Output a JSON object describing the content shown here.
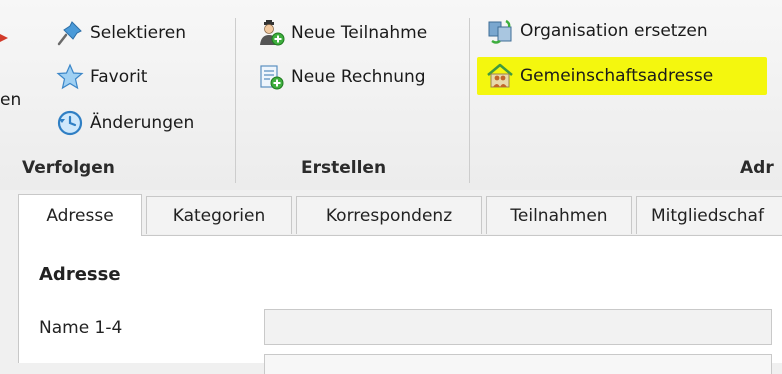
{
  "ribbon": {
    "left_cut_label": "en",
    "groups": [
      {
        "label": "Verfolgen",
        "buttons": [
          {
            "label": "Selektieren",
            "icon": "pin-icon"
          },
          {
            "label": "Favorit",
            "icon": "star-icon"
          },
          {
            "label": "Änderungen",
            "icon": "history-icon"
          }
        ]
      },
      {
        "label": "Erstellen",
        "buttons": [
          {
            "label": "Neue Teilnahme",
            "icon": "person-add-icon"
          },
          {
            "label": "Neue Rechnung",
            "icon": "invoice-add-icon"
          }
        ]
      },
      {
        "label": "Adr",
        "buttons": [
          {
            "label": "Organisation ersetzen",
            "icon": "replace-icon"
          },
          {
            "label": "Gemeinschaftsadresse",
            "icon": "house-people-icon",
            "highlighted": true
          }
        ]
      }
    ]
  },
  "tabs": [
    {
      "label": "Adresse",
      "active": true
    },
    {
      "label": "Kategorien",
      "active": false
    },
    {
      "label": "Korrespondenz",
      "active": false
    },
    {
      "label": "Teilnahmen",
      "active": false
    },
    {
      "label": "Mitgliedschaf",
      "active": false
    }
  ],
  "content": {
    "section_title": "Adresse",
    "fields": [
      {
        "label": "Name 1-4",
        "value": ""
      }
    ]
  },
  "colors": {
    "highlight": "#f4f70e",
    "ribbon_bg": "#f0f0f0",
    "content_bg": "#ffffff"
  }
}
